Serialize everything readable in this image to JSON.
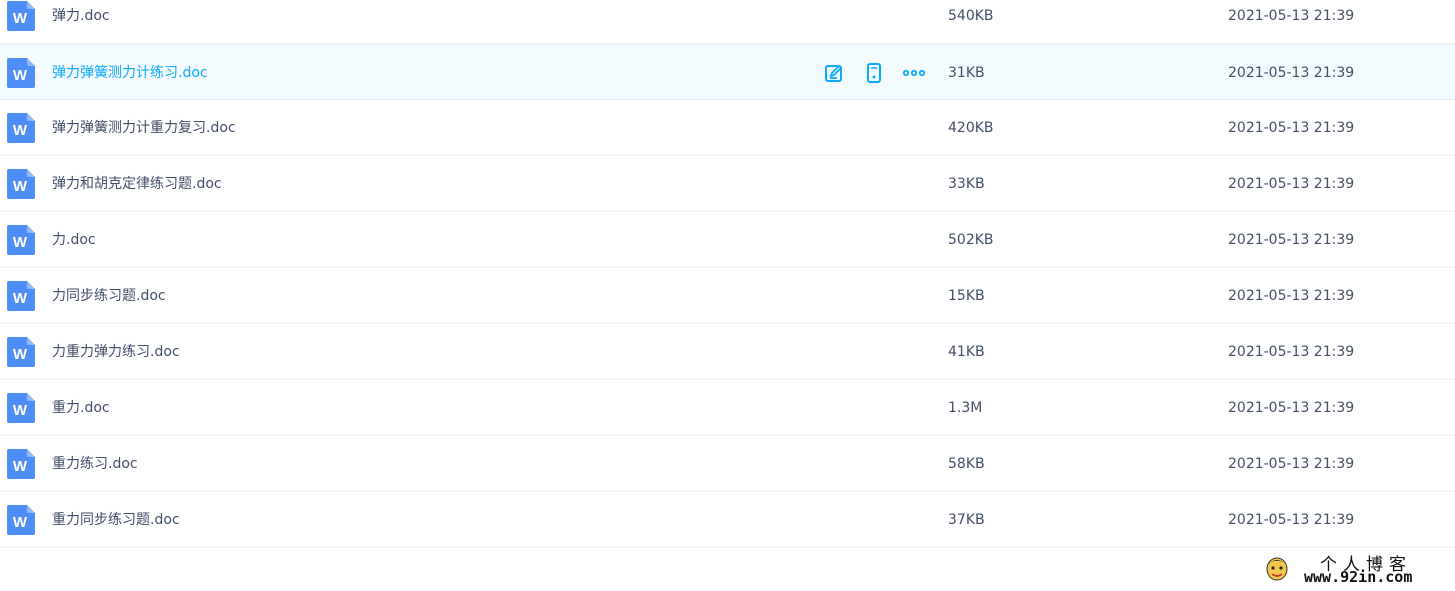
{
  "files": [
    {
      "name": "弹力.doc",
      "size": "540KB",
      "modified": "2021-05-13 21:39"
    },
    {
      "name": "弹力弹簧测力计练习.doc",
      "size": "31KB",
      "modified": "2021-05-13 21:39"
    },
    {
      "name": "弹力弹簧测力计重力复习.doc",
      "size": "420KB",
      "modified": "2021-05-13 21:39"
    },
    {
      "name": "弹力和胡克定律练习题.doc",
      "size": "33KB",
      "modified": "2021-05-13 21:39"
    },
    {
      "name": "力.doc",
      "size": "502KB",
      "modified": "2021-05-13 21:39"
    },
    {
      "name": "力同步练习题.doc",
      "size": "15KB",
      "modified": "2021-05-13 21:39"
    },
    {
      "name": "力重力弹力练习.doc",
      "size": "41KB",
      "modified": "2021-05-13 21:39"
    },
    {
      "name": "重力.doc",
      "size": "1.3M",
      "modified": "2021-05-13 21:39"
    },
    {
      "name": "重力练习.doc",
      "size": "58KB",
      "modified": "2021-05-13 21:39"
    },
    {
      "name": "重力同步练习题.doc",
      "size": "37KB",
      "modified": "2021-05-13 21:39"
    }
  ],
  "hovered_row_index": 1,
  "row_actions": [
    "edit-icon",
    "phone-icon",
    "more-icon"
  ],
  "file_icon_letter": "W",
  "colors": {
    "accent": "#09aaff",
    "text": "#424e67",
    "word_icon": "#4d8ef7",
    "hover_bg": "#f4fbff"
  },
  "watermark": {
    "title": "个人博客",
    "url": "www.92in.com"
  }
}
